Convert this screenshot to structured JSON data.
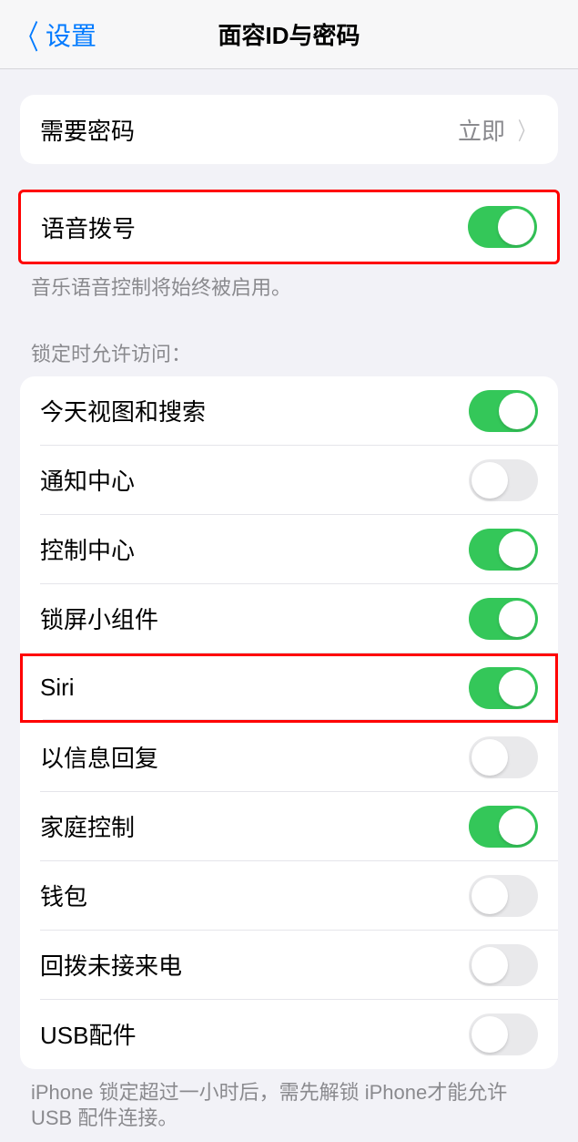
{
  "header": {
    "back_label": "设置",
    "title": "面容ID与密码"
  },
  "require_passcode": {
    "label": "需要密码",
    "value": "立即"
  },
  "voice_dial": {
    "label": "语音拨号",
    "on": true,
    "footer": "音乐语音控制将始终被启用。"
  },
  "allow_access": {
    "header": "锁定时允许访问：",
    "items": [
      {
        "label": "今天视图和搜索",
        "on": true
      },
      {
        "label": "通知中心",
        "on": false
      },
      {
        "label": "控制中心",
        "on": true
      },
      {
        "label": "锁屏小组件",
        "on": true
      },
      {
        "label": "Siri",
        "on": true,
        "highlighted": true
      },
      {
        "label": "以信息回复",
        "on": false
      },
      {
        "label": "家庭控制",
        "on": true
      },
      {
        "label": "钱包",
        "on": false
      },
      {
        "label": "回拨未接来电",
        "on": false
      },
      {
        "label": "USB配件",
        "on": false
      }
    ],
    "footer": "iPhone 锁定超过一小时后，需先解锁 iPhone才能允许USB 配件连接。"
  }
}
